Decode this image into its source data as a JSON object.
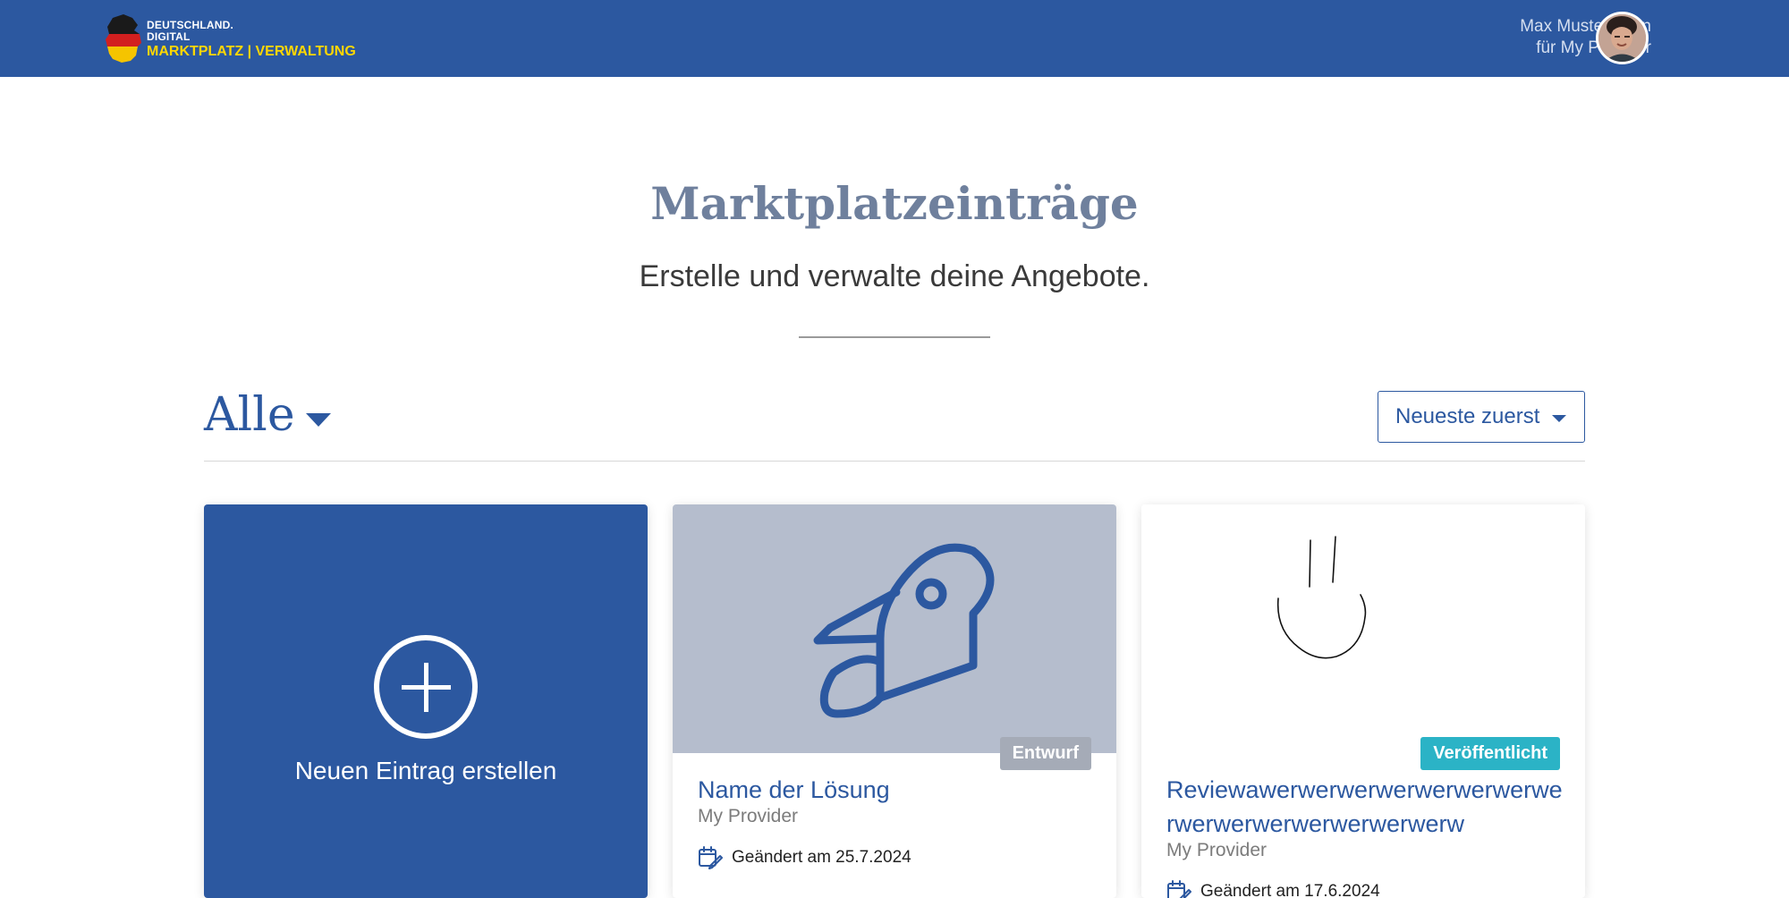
{
  "header": {
    "logo_line1": "DEUTSCHLAND.",
    "logo_line2": "DIGITAL",
    "logo_line3": "MARKTPLATZ | VERWALTUNG",
    "user_name": "Max Mustermann",
    "user_org": "für My Provider"
  },
  "page": {
    "title": "Marktplatzeinträge",
    "subtitle": "Erstelle und verwalte deine Angebote."
  },
  "filter": {
    "label": "Alle",
    "sort_label": "Neueste zuerst"
  },
  "cards": {
    "new": {
      "label": "Neuen Eintrag erstellen",
      "icon": "plus-circle-icon"
    },
    "items": [
      {
        "title": "Name der Lösung",
        "provider": "My Provider",
        "date": "Geändert am 25.7.2024",
        "status": "Entwurf",
        "icon": "rocket-icon"
      },
      {
        "title": "Reviewawerwerwerwerwerwerwerwerwerwerwerwerwerwerwerw",
        "provider": "My Provider",
        "date": "Geändert am 17.6.2024",
        "status": "Veröffentlicht",
        "icon": "sketch-image"
      }
    ]
  },
  "colors": {
    "primary": "#2c58a0",
    "accent_yellow": "#ffd700",
    "badge_draft": "#a5abb7",
    "badge_published": "#2bb3c6"
  }
}
